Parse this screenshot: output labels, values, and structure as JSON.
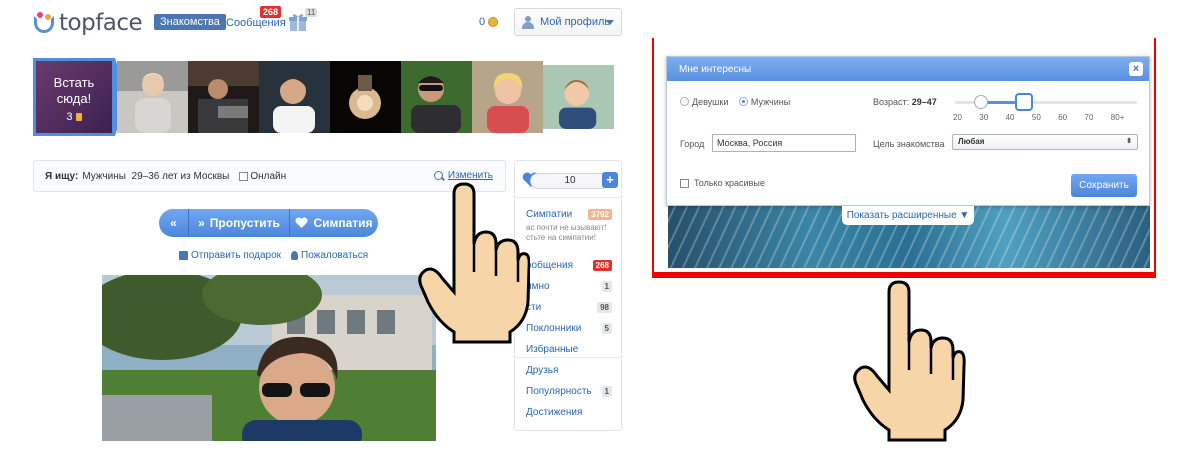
{
  "header": {
    "logo_text": "topface",
    "nav_dating": "Знакомства",
    "nav_messages": "Сообщения",
    "messages_badge": "268",
    "gifts_badge": "11",
    "coins": "0",
    "profile_button": "Мой профиль"
  },
  "strip": {
    "start_title": "Встать сюда!",
    "start_cost": "3"
  },
  "search": {
    "label": "Я ищу:",
    "criteria": "Мужчины  29–36 лет из Москвы",
    "online_label": "Онлайн",
    "change_link": "Изменить"
  },
  "actions": {
    "back": "«",
    "skip": "Пропустить",
    "like": "Симпатия",
    "send_gift": "Отправить подарок",
    "complain": "Пожаловаться"
  },
  "sidebar": {
    "likes_counter": "10",
    "plus": "+",
    "items": [
      {
        "label": "Симпатии",
        "count": "3792"
      },
      {
        "label": "ообщения",
        "count": "268"
      },
      {
        "label": "имно",
        "count": "1"
      },
      {
        "label": "сти",
        "count": "98"
      },
      {
        "label": "Поклонники",
        "count": "5"
      },
      {
        "label": "Избранные",
        "count": ""
      },
      {
        "label": "Друзья",
        "count": ""
      },
      {
        "label": "Популярность",
        "count": "1"
      },
      {
        "label": "Достижения",
        "count": ""
      }
    ],
    "likes_note": "ас почти не ызывают! стьте на симпатии!"
  },
  "dialog": {
    "title": "Мне интересны",
    "close": "×",
    "gender_options": [
      "Девушки",
      "Мужчины"
    ],
    "gender_selected": "Мужчины",
    "age_label": "Возраст:",
    "age_value": "29–47",
    "age_min": 29,
    "age_max": 47,
    "age_ticks": [
      "20",
      "30",
      "40",
      "50",
      "60",
      "70",
      "80+"
    ],
    "city_label": "Город",
    "city_value": "Москва, Россия",
    "goal_label": "Цель знакомства",
    "goal_value": "Любая",
    "only_pretty": "Только красивые",
    "save": "Сохранить",
    "show_more": "Показать расширенные ▼"
  },
  "colors": {
    "accent": "#4c86dc",
    "badge_red": "#e0312c",
    "highlight_frame": "#e00000"
  }
}
